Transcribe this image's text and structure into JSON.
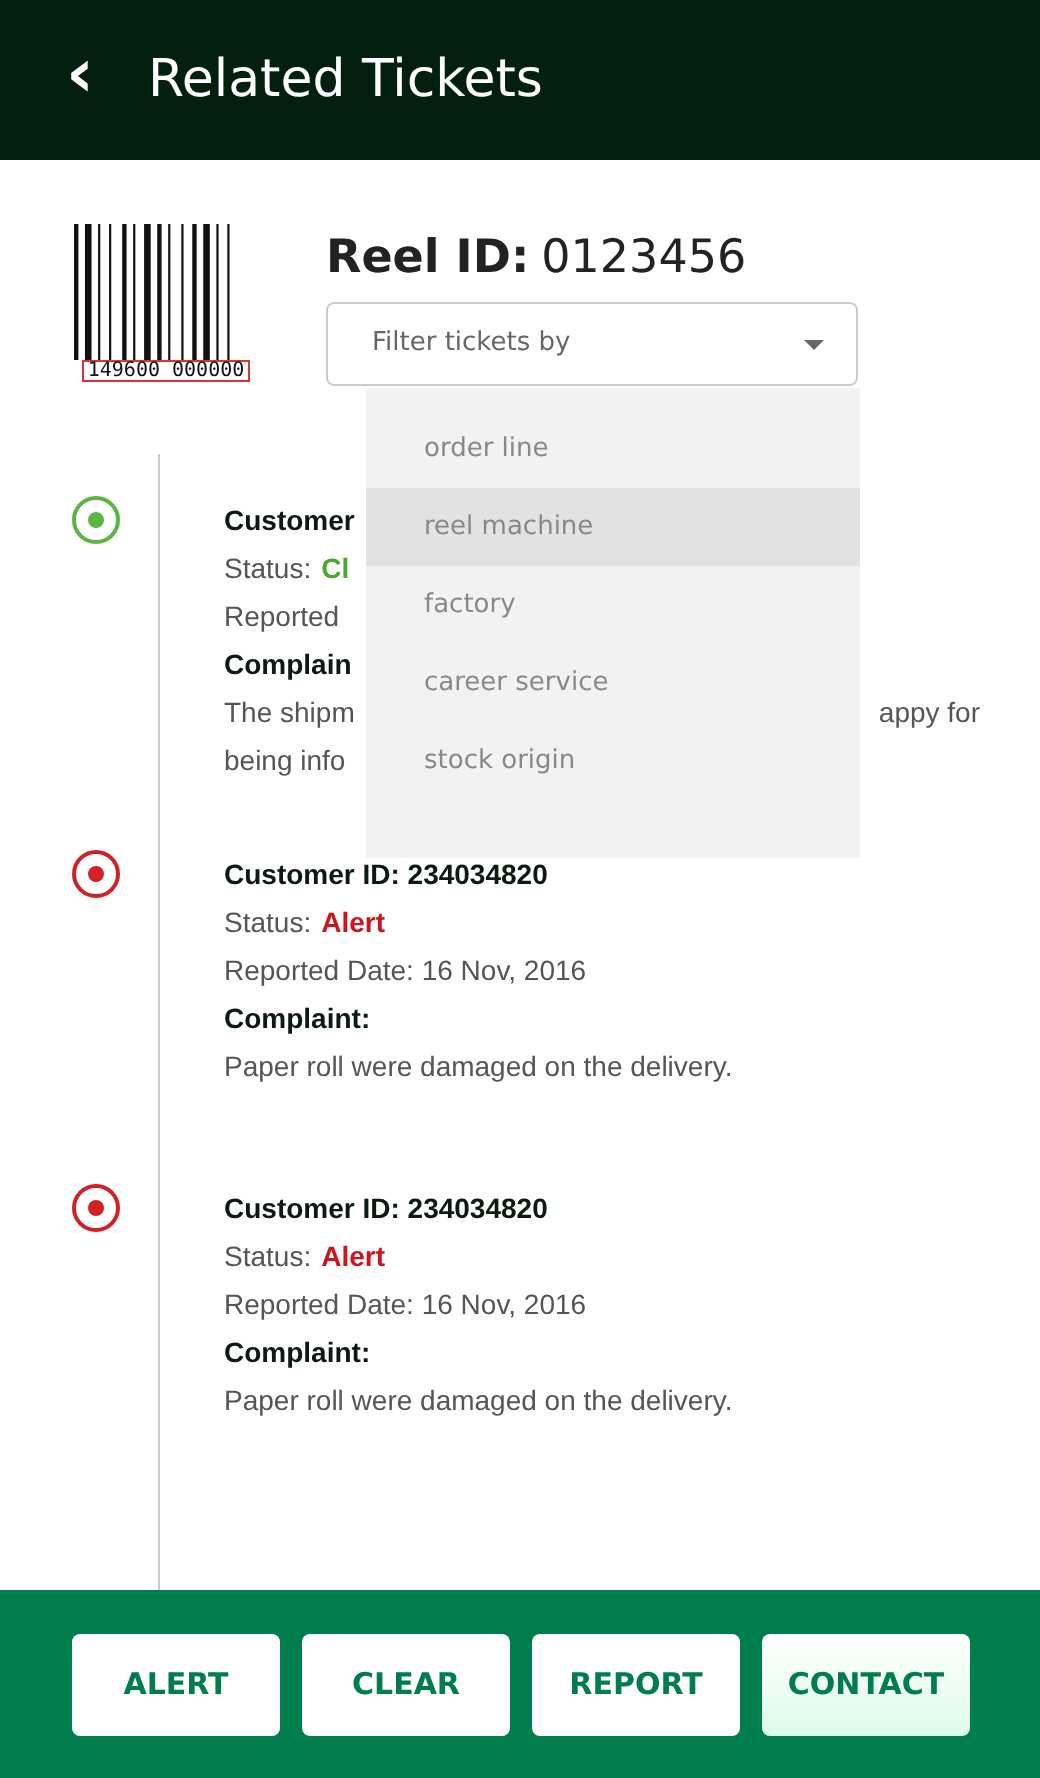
{
  "header": {
    "back_icon": "‹",
    "title": "Related Tickets"
  },
  "barcode": {
    "number": "149600 000000"
  },
  "reel": {
    "label": "Reel ID:",
    "value": "0123456"
  },
  "filter": {
    "placeholder": "Filter tickets by",
    "options": [
      {
        "label": "order line",
        "selected": false
      },
      {
        "label": "reel machine",
        "selected": true
      },
      {
        "label": "factory",
        "selected": false
      },
      {
        "label": "career service",
        "selected": false
      },
      {
        "label": "stock origin",
        "selected": false
      }
    ]
  },
  "tickets": [
    {
      "kind": "clear",
      "customer": "Customer",
      "status_label": "Status:",
      "status": "Cl",
      "reported": "Reported",
      "complaint": "Complain",
      "description": [
        {
          "left": "The shipm",
          "right": "appy for"
        },
        {
          "left": "being info"
        }
      ]
    },
    {
      "kind": "alert",
      "customer": "Customer ID: 234034820",
      "status_label": "Status:",
      "status": "Alert",
      "reported": "Reported Date: 16 Nov, 2016",
      "complaint": "Complaint:",
      "description": [
        {
          "left": "Paper roll were damaged on the delivery."
        }
      ]
    },
    {
      "kind": "alert",
      "customer": "Customer ID: 234034820",
      "status_label": "Status:",
      "status": "Alert",
      "reported": "Reported Date: 16 Nov, 2016",
      "complaint": "Complaint:",
      "description": [
        {
          "left": "Paper roll were damaged on the delivery."
        }
      ]
    }
  ],
  "actions": [
    {
      "label": "ALERT",
      "selected": false
    },
    {
      "label": "CLEAR",
      "selected": false
    },
    {
      "label": "REPORT",
      "selected": false
    },
    {
      "label": "CONTACT",
      "selected": true
    }
  ]
}
